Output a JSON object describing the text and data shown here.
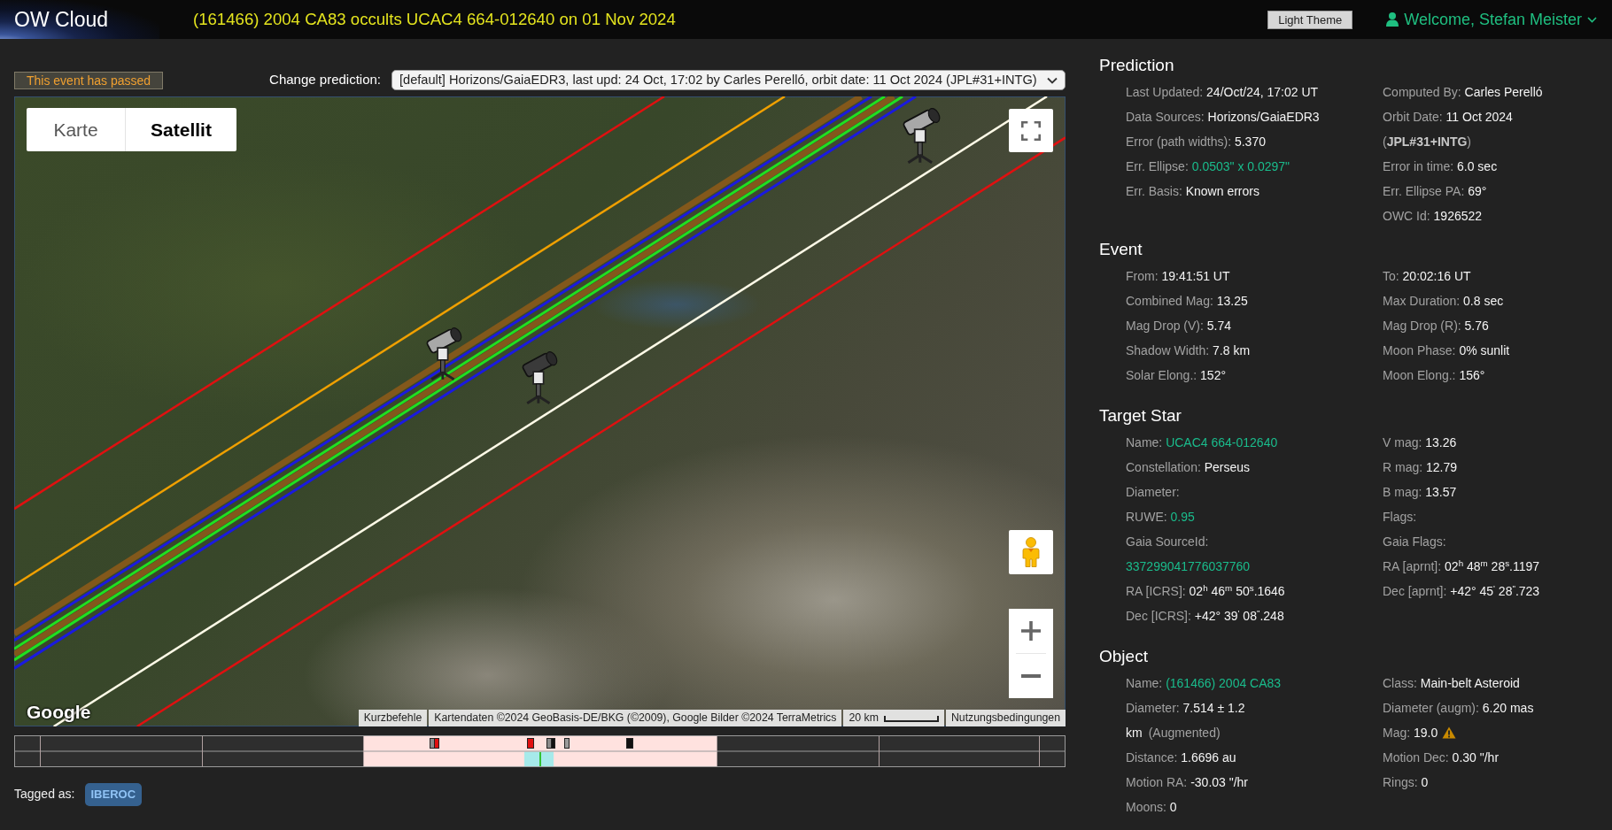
{
  "header": {
    "brand": "OW Cloud",
    "title": "(161466) 2004 CA83 occults UCAC4 664-012640 on 01 Nov 2024",
    "theme_button": "Light Theme",
    "user_menu": "Welcome, Stefan Meister"
  },
  "status_badge": "This event has passed",
  "prediction_picker": {
    "label": "Change prediction:",
    "value": "[default] Horizons/GaiaEDR3, last upd: 24 Oct, 17:02 by Carles Perelló, orbit date: 11 Oct 2024 (JPL#31+INTG)"
  },
  "map": {
    "map_types": [
      {
        "label": "Karte",
        "selected": false
      },
      {
        "label": "Satellit",
        "selected": true
      }
    ],
    "logo": "Google",
    "attribution": {
      "shortcuts": "Kurzbefehle",
      "data": "Kartendaten ©2024 GeoBasis-DE/BKG (©2009), Google Bilder ©2024 TerraMetrics",
      "scale": "20 km",
      "terms": "Nutzungsbedingungen"
    }
  },
  "tags": {
    "label": "Tagged as:",
    "items": [
      "IBEROC"
    ]
  },
  "sections": [
    {
      "title": "Prediction",
      "left": [
        {
          "label": "Last Updated:",
          "value": "24/Oct/24, 17:02 UT",
          "kind": "text"
        },
        {
          "label": "Data Sources:",
          "value": "Horizons/GaiaEDR3",
          "kind": "text"
        },
        {
          "label": "Error (path widths):",
          "value": "5.370",
          "kind": "text"
        },
        {
          "label": "Err. Ellipse:",
          "value": "0.0503\" x 0.0297\"",
          "kind": "good"
        },
        {
          "label": "Err. Basis:",
          "value": "Known errors",
          "kind": "text"
        }
      ],
      "right": [
        {
          "label": "Computed By:",
          "value": "Carles Perelló",
          "kind": "text"
        },
        {
          "label": "Orbit Date:",
          "value": "11 Oct 2024",
          "note": "(**JPL#31+INTG**)",
          "kind": "text"
        },
        {
          "label": "Error in time:",
          "value": "6.0 sec",
          "kind": "text"
        },
        {
          "label": "Err. Ellipse PA:",
          "value": "69°",
          "kind": "text"
        },
        {
          "label": "OWC Id:",
          "value": "1926522",
          "kind": "text"
        }
      ]
    },
    {
      "title": "Event",
      "left": [
        {
          "label": "From:",
          "value": "19:41:51 UT",
          "kind": "text"
        },
        {
          "label": "Combined Mag:",
          "value": "13.25",
          "kind": "text"
        },
        {
          "label": "Mag Drop (V):",
          "value": "5.74",
          "kind": "text"
        },
        {
          "label": "Shadow Width:",
          "value": "7.8 km",
          "kind": "text"
        },
        {
          "label": "Solar Elong.:",
          "value": "152°",
          "kind": "text"
        }
      ],
      "right": [
        {
          "label": "To:",
          "value": "20:02:16 UT",
          "kind": "text"
        },
        {
          "label": "Max Duration:",
          "value": "0.8 sec",
          "kind": "text"
        },
        {
          "label": "Mag Drop (R):",
          "value": "5.76",
          "kind": "text"
        },
        {
          "label": "Moon Phase:",
          "value": "0% sunlit",
          "kind": "text"
        },
        {
          "label": "Moon Elong.:",
          "value": "156°",
          "kind": "text"
        }
      ]
    },
    {
      "title": "Target Star",
      "left": [
        {
          "label": "Name:",
          "value": "UCAC4 664-012640",
          "kind": "link"
        },
        {
          "label": "Constellation:",
          "value": "Perseus",
          "kind": "text"
        },
        {
          "label": "Diameter:"
        },
        {
          "label": "RUWE:",
          "value": "0.95",
          "kind": "good"
        },
        {
          "label": "Gaia SourceId:",
          "value": "337299041776037760",
          "kind": "link"
        },
        {
          "label": "RA [ICRS]:",
          "value": "02$^{h}$ 46$^{m}$ 50$^{s}$.1646",
          "kind": "text"
        },
        {
          "label": "Dec [ICRS]:",
          "value": "+42° 39$^{'}$ 08$^{\"}$.248",
          "kind": "text"
        }
      ],
      "right": [
        {
          "label": "V mag:",
          "value": "13.26",
          "kind": "text"
        },
        {
          "label": "R mag:",
          "value": "12.79",
          "kind": "text"
        },
        {
          "label": "B mag:",
          "value": "13.57",
          "kind": "text"
        },
        {
          "label": "Flags:"
        },
        {
          "label": "Gaia Flags:"
        },
        {
          "label": "RA [aprnt]:",
          "value": "02$^{h}$ 48$^{m}$ 28$^{s}$.1197",
          "kind": "text"
        },
        {
          "label": "Dec [aprnt]:",
          "value": "+42° 45$^{'}$ 28$^{\"}$.723",
          "kind": "text"
        }
      ]
    },
    {
      "title": "Object",
      "left": [
        {
          "label": "Name:",
          "value": "(161466) 2004 CA83",
          "kind": "link"
        },
        {
          "label": "Diameter:",
          "value": "7.514 ± 1.2",
          "unit": "km",
          "note": "(Augmented)",
          "kind": "text"
        },
        {
          "label": "Distance:",
          "value": "1.6696 au",
          "kind": "text"
        },
        {
          "label": "Motion RA:",
          "value": "-30.03 \"/hr",
          "kind": "text"
        },
        {
          "label": "Moons:",
          "value": "0",
          "kind": "text"
        }
      ],
      "right": [
        {
          "label": "Class:",
          "value": "Main-belt Asteroid",
          "kind": "text"
        },
        {
          "label": "Diameter (augm):",
          "value": "6.20 mas",
          "kind": "text"
        },
        {
          "label": "Mag:",
          "value": "19.0",
          "kind": "flagged"
        },
        {
          "label": "Motion Dec:",
          "value": "0.30 \"/hr",
          "kind": "text"
        },
        {
          "label": "Rings:",
          "value": "0",
          "kind": "text"
        }
      ]
    }
  ]
}
